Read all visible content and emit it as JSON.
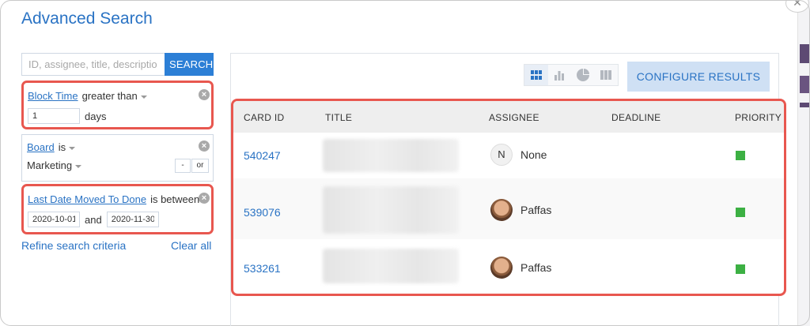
{
  "title": "Advanced Search",
  "search": {
    "placeholder": "ID, assignee, title, descriptio",
    "button": "SEARCH"
  },
  "filters": [
    {
      "field": "Block Time",
      "operator": "greater than",
      "value": "1",
      "unit": "days"
    },
    {
      "field": "Board",
      "operator": "is",
      "value": "Marketing",
      "btn_minus": "-",
      "btn_or": "or"
    },
    {
      "field": "Last Date Moved To Done",
      "operator": "is between",
      "from": "2020-10-01",
      "and": "and",
      "to": "2020-11-30"
    }
  ],
  "links": {
    "refine": "Refine search criteria",
    "clear": "Clear all"
  },
  "results": {
    "configure": "CONFIGURE RESULTS",
    "columns": [
      "CARD ID",
      "TITLE",
      "ASSIGNEE",
      "DEADLINE",
      "PRIORITY"
    ],
    "rows": [
      {
        "id": "540247",
        "assignee": "None",
        "avatar_letter": "N",
        "priority_color": "#3cb043"
      },
      {
        "id": "539076",
        "assignee": "Paffas",
        "priority_color": "#3cb043"
      },
      {
        "id": "533261",
        "assignee": "Paffas",
        "priority_color": "#3cb043"
      }
    ]
  },
  "colors": {
    "accent": "#2a73c4",
    "highlight": "#e8574f",
    "priority_low": "#3cb043"
  },
  "icons": [
    "close-icon",
    "remove-filter-icon",
    "grid-view-icon",
    "bar-chart-icon",
    "pie-chart-icon",
    "column-view-icon"
  ]
}
